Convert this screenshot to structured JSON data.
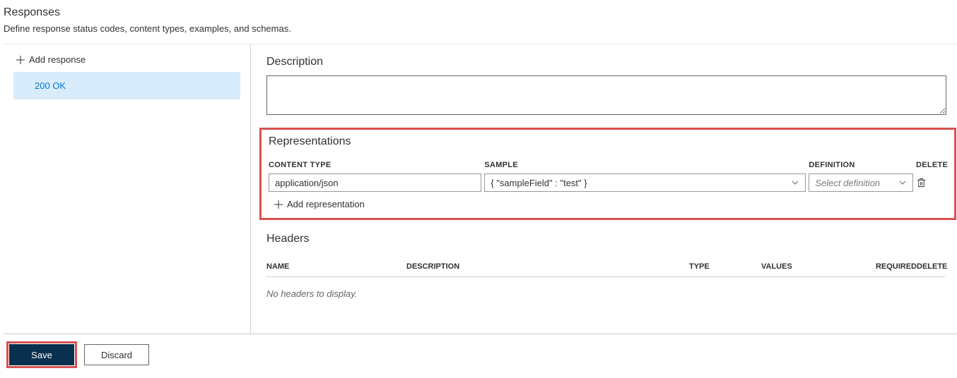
{
  "responses": {
    "title": "Responses",
    "subtitle": "Define response status codes, content types, examples, and schemas.",
    "add_label": "Add response",
    "items": [
      {
        "label": "200 OK"
      }
    ]
  },
  "detail": {
    "description_label": "Description",
    "description_value": "",
    "representations": {
      "title": "Representations",
      "columns": {
        "content_type": "CONTENT TYPE",
        "sample": "SAMPLE",
        "definition": "DEFINITION",
        "delete": "DELETE"
      },
      "rows": [
        {
          "content_type": "application/json",
          "sample": "{ \"sampleField\" : \"test\" }",
          "definition_placeholder": "Select definition"
        }
      ],
      "add_label": "Add representation"
    },
    "headers": {
      "title": "Headers",
      "columns": {
        "name": "NAME",
        "description": "DESCRIPTION",
        "type": "TYPE",
        "values": "VALUES",
        "required": "REQUIRED",
        "delete": "DELETE"
      },
      "empty_text": "No headers to display."
    }
  },
  "footer": {
    "save": "Save",
    "discard": "Discard"
  }
}
